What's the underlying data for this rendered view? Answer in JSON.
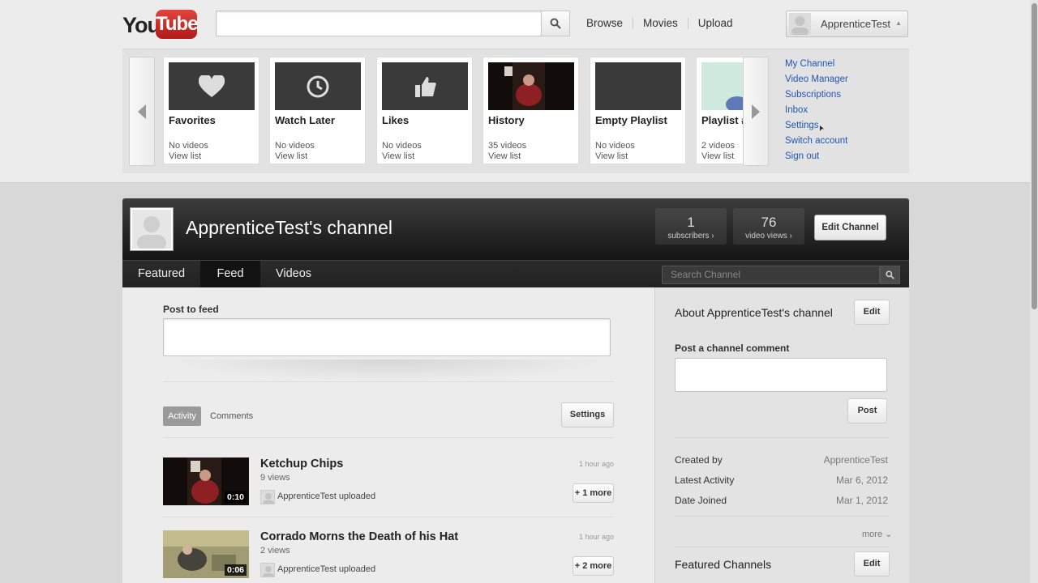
{
  "brand": {
    "you": "You",
    "tube": "Tube"
  },
  "masthead": {
    "search_placeholder": "",
    "nav": [
      "Browse",
      "Movies",
      "Upload"
    ],
    "user_name": "ApprenticeTest"
  },
  "playlists": [
    {
      "title": "Favorites",
      "count": "No videos",
      "view": "View list",
      "icon": "heart-icon"
    },
    {
      "title": "Watch Later",
      "count": "No videos",
      "view": "View list",
      "icon": "clock-icon"
    },
    {
      "title": "Likes",
      "count": "No videos",
      "view": "View list",
      "icon": "thumbs-up-icon"
    },
    {
      "title": "History",
      "count": "35 videos",
      "view": "View list",
      "icon": "video-thumbnail"
    },
    {
      "title": "Empty Playlist",
      "count": "No videos",
      "view": "View list",
      "icon": ""
    },
    {
      "title": "Playlist #",
      "count": "2 videos",
      "view": "View list",
      "icon": "video-thumbnail"
    }
  ],
  "user_menu": [
    "My Channel",
    "Video Manager",
    "Subscriptions",
    "Inbox",
    "Settings",
    "Switch account",
    "Sign out"
  ],
  "channel": {
    "title": "ApprenticeTest's channel",
    "subscribers": {
      "value": "1",
      "label": "subscribers ›"
    },
    "views": {
      "value": "76",
      "label": "video views ›"
    },
    "edit_label": "Edit Channel",
    "tabs": [
      "Featured",
      "Feed",
      "Videos"
    ],
    "active_tab": "Feed",
    "search_placeholder": "Search Channel"
  },
  "feed": {
    "post_label": "Post to feed",
    "tabs": {
      "activity": "Activity",
      "comments": "Comments"
    },
    "settings_label": "Settings",
    "items": [
      {
        "title": "Ketchup Chips",
        "views": "9 views",
        "who": "ApprenticeTest uploaded",
        "time": "1 hour ago",
        "duration": "0:10",
        "more": "+ 1 more"
      },
      {
        "title": "Corrado Morns the Death of his Hat",
        "views": "2 views",
        "who": "ApprenticeTest uploaded",
        "time": "1 hour ago",
        "duration": "0:06",
        "more": "+ 2 more"
      }
    ]
  },
  "sidebar": {
    "about_title": "About ApprenticeTest's channel",
    "edit_label": "Edit",
    "post_comment_label": "Post a channel comment",
    "post_label": "Post",
    "info": [
      {
        "label": "Created by",
        "value": "ApprenticeTest"
      },
      {
        "label": "Latest Activity",
        "value": "Mar 6, 2012"
      },
      {
        "label": "Date Joined",
        "value": "Mar 1, 2012"
      }
    ],
    "more_label": "more ⌄",
    "featured_title": "Featured Channels",
    "featured_edit": "Edit"
  },
  "colors": {
    "brand_red": "#cc2020",
    "link_blue": "#2356b3",
    "header_dark": "#1b1b1b"
  }
}
